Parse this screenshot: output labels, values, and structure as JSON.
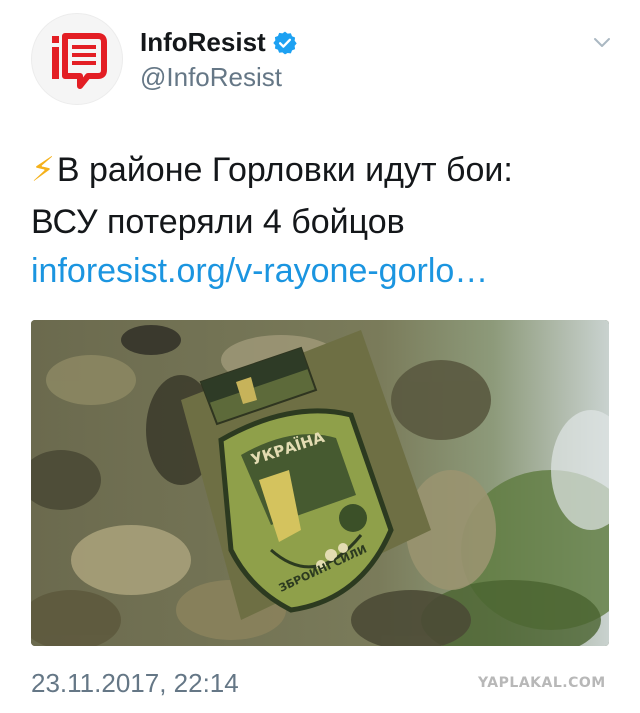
{
  "author": {
    "display_name": "InfoResist",
    "handle": "@InfoResist",
    "verified": true,
    "avatar_icon": "inforesist-logo",
    "brand_color": "#e31e24"
  },
  "tweet": {
    "emoji": "⚡",
    "text_line1": "В районе Горловки идут бои:",
    "text_line2": "ВСУ потеряли 4 бойцов",
    "link": "inforesist.org/v-rayone-gorlo…",
    "link_color": "#1b95e0",
    "media": {
      "description_icon": "military-sleeve-patch-photo",
      "patch_top_text": "УКРАЇНА",
      "patch_bottom_text": "ЗБРОЙНІ СИЛИ"
    },
    "timestamp": "23.11.2017, 22:14"
  },
  "menu_icon": "chevron-down-icon",
  "watermark": "YAPLAKAL.COM"
}
